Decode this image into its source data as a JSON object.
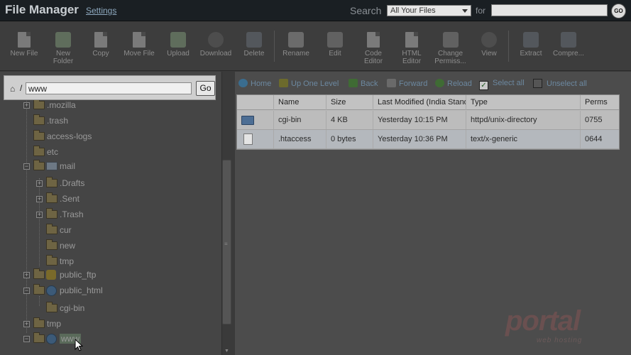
{
  "header": {
    "title": "File Manager",
    "settings_link": "Settings",
    "search_label": "Search",
    "search_scope": "All Your Files",
    "for_label": "for",
    "search_value": "",
    "go_label": "GO"
  },
  "toolbar": {
    "items": [
      {
        "label": "New File",
        "icon": "new-file-icon"
      },
      {
        "label": "New Folder",
        "icon": "new-folder-icon"
      },
      {
        "label": "Copy",
        "icon": "copy-icon"
      },
      {
        "label": "Move File",
        "icon": "move-file-icon"
      },
      {
        "label": "Upload",
        "icon": "upload-icon"
      },
      {
        "label": "Download",
        "icon": "download-icon"
      },
      {
        "label": "Delete",
        "icon": "delete-icon"
      },
      {
        "label": "Rename",
        "icon": "rename-icon"
      },
      {
        "label": "Edit",
        "icon": "edit-icon"
      },
      {
        "label": "Code Editor",
        "icon": "code-editor-icon"
      },
      {
        "label": "HTML Editor",
        "icon": "html-editor-icon"
      },
      {
        "label": "Change Permiss...",
        "icon": "change-permissions-icon"
      },
      {
        "label": "View",
        "icon": "view-icon"
      },
      {
        "label": "Extract",
        "icon": "extract-icon"
      },
      {
        "label": "Compre...",
        "icon": "compress-icon"
      }
    ]
  },
  "path": {
    "slash": "/",
    "value": "www",
    "go_label": "Go"
  },
  "tree": {
    "items": [
      {
        "label": ".mozilla",
        "icon": "folder-icon"
      },
      {
        "label": ".trash",
        "icon": "folder-icon"
      },
      {
        "label": "access-logs",
        "icon": "folder-icon"
      },
      {
        "label": "etc",
        "icon": "folder-icon"
      },
      {
        "label": "mail",
        "icon": "mail-folder-icon"
      },
      {
        "label": ".Drafts",
        "icon": "folder-icon"
      },
      {
        "label": ".Sent",
        "icon": "folder-icon"
      },
      {
        "label": ".Trash",
        "icon": "folder-icon"
      },
      {
        "label": "cur",
        "icon": "folder-icon"
      },
      {
        "label": "new",
        "icon": "folder-icon"
      },
      {
        "label": "tmp",
        "icon": "folder-icon"
      },
      {
        "label": "public_ftp",
        "icon": "ftp-folder-icon"
      },
      {
        "label": "public_html",
        "icon": "globe-folder-icon"
      },
      {
        "label": "cgi-bin",
        "icon": "folder-icon"
      },
      {
        "label": "tmp",
        "icon": "folder-icon"
      },
      {
        "label": "www",
        "icon": "globe-folder-icon"
      }
    ]
  },
  "nav": {
    "home": "Home",
    "up": "Up One Level",
    "back": "Back",
    "forward": "Forward",
    "reload": "Reload",
    "select_all": "Select all",
    "unselect_all": "Unselect all"
  },
  "table": {
    "columns": [
      "Name",
      "Size",
      "Last Modified (India Standard Time)",
      "Type",
      "Perms"
    ],
    "rows": [
      {
        "name": "cgi-bin",
        "size": "4 KB",
        "modified": "Yesterday 10:15 PM",
        "type": "httpd/unix-directory",
        "perms": "0755",
        "icon": "folder-icon"
      },
      {
        "name": ".htaccess",
        "size": "0 bytes",
        "modified": "Yesterday 10:36 PM",
        "type": "text/x-generic",
        "perms": "0644",
        "icon": "document-icon"
      }
    ]
  },
  "watermark": {
    "main": "portal",
    "sub": "web hosting"
  }
}
